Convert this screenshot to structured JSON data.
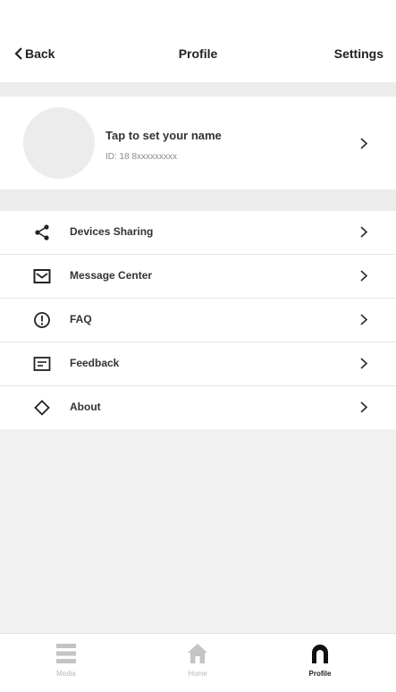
{
  "header": {
    "back_label": "Back",
    "title": "Profile",
    "settings_label": "Settings"
  },
  "profile": {
    "name_prompt": "Tap to set your name",
    "id_text": "ID: 18 8xxxxxxxxx"
  },
  "menu": {
    "items": [
      {
        "label": "Devices Sharing",
        "icon": "share-icon"
      },
      {
        "label": "Message Center",
        "icon": "message-icon"
      },
      {
        "label": "FAQ",
        "icon": "help-icon"
      },
      {
        "label": "Feedback",
        "icon": "feedback-icon"
      },
      {
        "label": "About",
        "icon": "about-icon"
      }
    ]
  },
  "tabbar": {
    "tabs": [
      {
        "label": "Media",
        "icon": "media-icon",
        "active": false
      },
      {
        "label": "Home",
        "icon": "home-icon",
        "active": false
      },
      {
        "label": "Profile",
        "icon": "profile-icon",
        "active": true
      }
    ]
  },
  "colors": {
    "background": "#ffffff",
    "separator": "#ececec",
    "text": "#222222",
    "inactive_tab": "#b8b8b8"
  }
}
